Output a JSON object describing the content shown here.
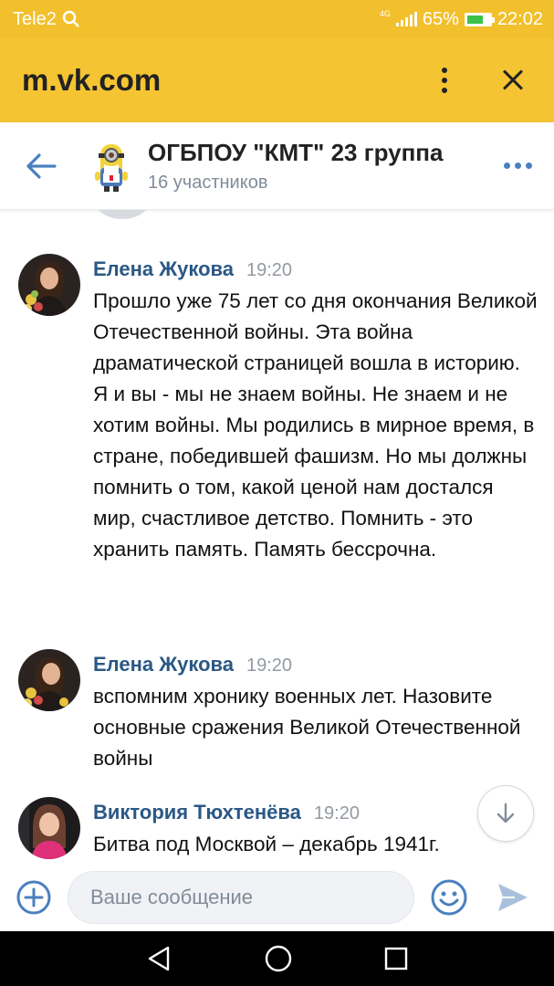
{
  "status_bar": {
    "carrier": "Tele2",
    "network": "4G",
    "battery": "65%",
    "battery_level": 0.65,
    "time": "22:02"
  },
  "browser": {
    "url": "m.vk.com"
  },
  "chat": {
    "title": "ОГБПОУ \"КМТ\" 23 группа",
    "subtitle": "16 участников"
  },
  "messages": [
    {
      "author": "Елена Жукова",
      "time": "19:20",
      "paragraphs": [
        "Прошло уже 75 лет со дня окончания Великой Отечественной войны. Эта война драматической страницей вошла в историю.",
        "Я и вы - мы не знаем войны. Не знаем и не хотим войны. Мы родились в мирное время, в стране, победившей фашизм. Но мы должны помнить о том, какой ценой нам достался мир, счастливое детство. Помнить - это хранить память. Память бессрочна."
      ]
    },
    {
      "author": "Елена Жукова",
      "time": "19:20",
      "paragraphs": [
        "вспомним хронику военных лет. Назовите основные сражения Великой Отечественной войны"
      ]
    },
    {
      "author": "Виктория Тюхтенёва",
      "time": "19:20",
      "paragraphs": [
        "Битва под Москвой – декабрь 1941г."
      ]
    }
  ],
  "composer": {
    "placeholder": "Ваше сообщение"
  },
  "colors": {
    "browser_bar": "#f4c432",
    "accent": "#4a80c0",
    "author_link": "#2a5885"
  }
}
